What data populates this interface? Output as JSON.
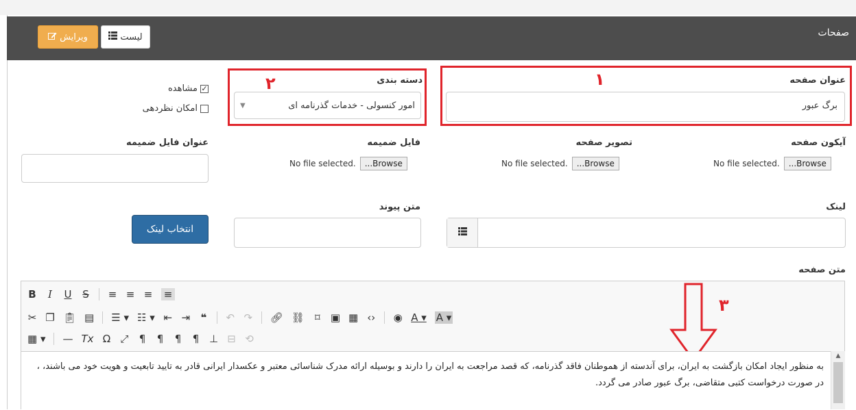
{
  "header": {
    "title": "صفحات",
    "edit_button": "ویرایش",
    "list_button": "لیست"
  },
  "annotations": {
    "num1": "۱",
    "num2": "۲",
    "num3": "۳"
  },
  "form": {
    "page_title_label": "عنوان صفحه",
    "page_title_value": "برگ عبور",
    "category_label": "دسته بندی",
    "category_value": "امور کنسولی - خدمات گذرنامه ای",
    "view_label": "مشاهده",
    "comment_label": "امکان نظردهی",
    "page_icon_label": "آیکون صفحه",
    "page_image_label": "تصویر صفحه",
    "attachment_label": "فایل ضمیمه",
    "attachment_title_label": "عنوان فایل ضمیمه",
    "browse_label": "...Browse",
    "no_file_text": "No file selected.",
    "link_label": "لینک",
    "link_text_label": "متن پیوند",
    "select_link_button": "انتخاب لینک",
    "page_text_label": "متن صفحه"
  },
  "editor": {
    "content": "به منظور ایجاد امکان بازگشت به ایران، برای آندسته از هموطنان فاقد گذرنامه، که قصد مراجعت به ایران را دارند و بوسیله ارائه مدرک شناسائی معتبر و عکسدار ایرانی قادر به تایید تابعیت و هویت خود می باشند، ، در صورت درخواست کتبی متقاضی، برگ عبور صادر می گردد."
  },
  "colors": {
    "header_bg": "#4d4d4d",
    "edit_button": "#f0ad4e",
    "primary_button": "#2e6da4",
    "annotation_red": "#e0242b"
  }
}
